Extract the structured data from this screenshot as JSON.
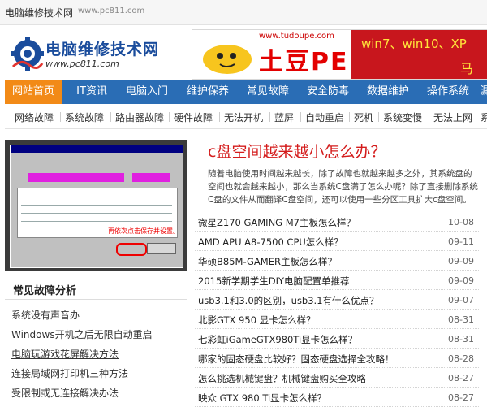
{
  "topbar": {
    "site_name": "电脑维修技术网",
    "url": "www.pc811.com"
  },
  "logo": {
    "title": "电脑维修技术网",
    "url": "www.pc811.com",
    "icon": "gear-wave-logo"
  },
  "banner": {
    "url": "www.tudoupe.com",
    "brand": "土豆PE",
    "tagline": "win7、win10、XP",
    "tagline_cut": "马"
  },
  "nav": {
    "items": [
      "网站首页",
      "IT资讯",
      "电脑入门",
      "维护保养",
      "常见故障",
      "安全防毒",
      "数据维护",
      "操作系统",
      "漏"
    ],
    "active_index": 0
  },
  "subnav": {
    "items": [
      "网络故障",
      "系统故障",
      "路由器故障",
      "硬件故障",
      "无法开机",
      "蓝屏",
      "自动重启",
      "死机",
      "系统变慢",
      "无法上网",
      "系"
    ]
  },
  "screenshot": {
    "note": "再依次点击保存并设置。"
  },
  "sidebar": {
    "title": "常见故障分析",
    "links": [
      "系统没有声音办",
      "Windows开机之后无限自动重启",
      "电脑玩游戏花屏解决方法",
      "连接局域网打印机三种方法",
      "受限制或无连接解决办法"
    ]
  },
  "article": {
    "title": "c盘空间越来越小怎么办？",
    "summary": "随着电脑使用时间越来越长，除了故障也就越来越多之外，其系统盘的空间也就会越来越小，那么当系统C盘满了怎么办呢？除了直接删除系统C盘的文件从而翻译C盘空间，还可以使用一些分区工具扩大c盘空间。"
  },
  "news": [
    {
      "title": "微星Z170 GAMING M7主板怎么样？",
      "date": "10-08"
    },
    {
      "title": "AMD APU A8-7500 CPU怎么样？",
      "date": "09-11"
    },
    {
      "title": "华硕B85M-GAMER主板怎么样？",
      "date": "09-09"
    },
    {
      "title": "2015新学期学生DIY电脑配置单推荐",
      "date": "09-09"
    },
    {
      "title": "usb3.1和3.0的区别，usb3.1有什么优点？",
      "date": "09-07"
    },
    {
      "title": "北影GTX 950 显卡怎么样？",
      "date": "08-31"
    },
    {
      "title": "七彩虹iGameGTX980Ti显卡怎么样？",
      "date": "08-31"
    },
    {
      "title": "哪家的固态硬盘比较好？固态硬盘选择全攻略！",
      "date": "08-28"
    },
    {
      "title": "怎么挑选机械键盘？机械键盘购买全攻略",
      "date": "08-27"
    },
    {
      "title": "映众 GTX 980 Ti显卡怎么样？",
      "date": "08-27"
    }
  ],
  "colors": {
    "nav_bg": "#2a6db5",
    "nav_active": "#f28a17",
    "article_title": "#d41c1c",
    "banner_red": "#c8161d"
  }
}
